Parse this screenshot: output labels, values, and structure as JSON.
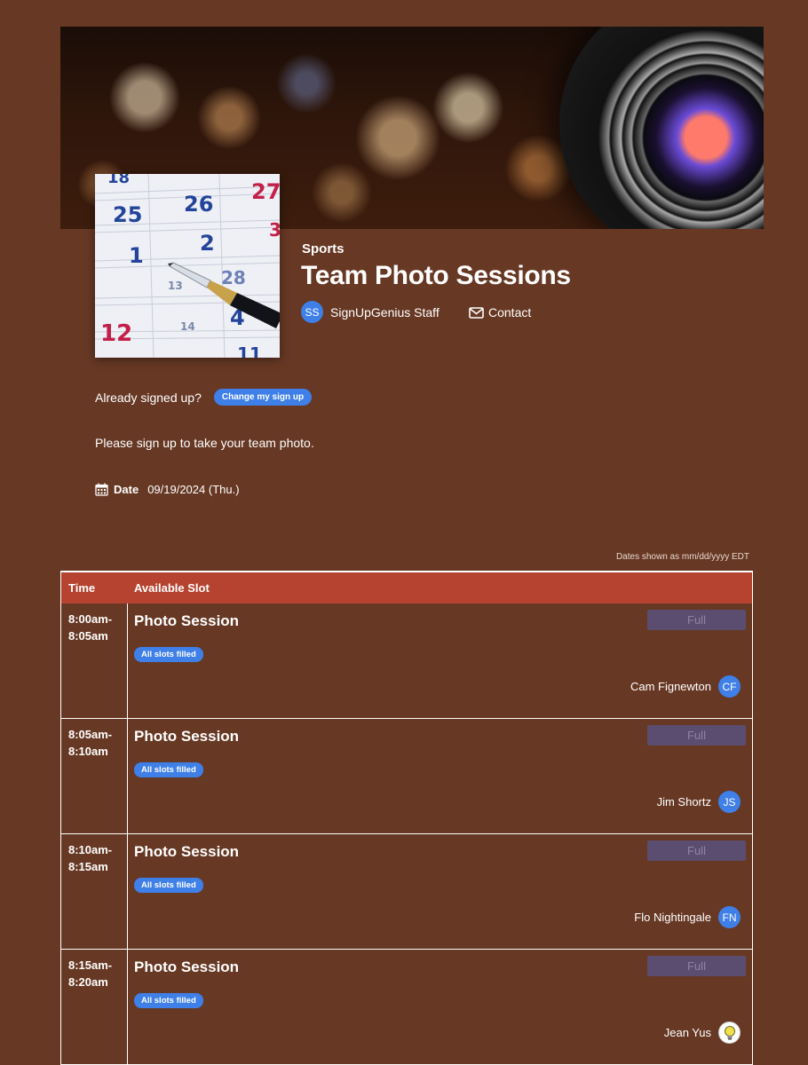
{
  "header": {
    "category": "Sports",
    "title": "Team Photo Sessions",
    "organizer": {
      "initials": "SS",
      "name": "SignUpGenius Staff"
    },
    "contact_label": "Contact"
  },
  "thumbnail": {
    "dates": [
      "18",
      "25",
      "26",
      "27",
      "1",
      "2",
      "3",
      "12",
      "13",
      "14",
      "4",
      "28",
      "11"
    ]
  },
  "signed_up": {
    "prompt": "Already signed up?",
    "button_label": "Change my sign up"
  },
  "description": "Please sign up to take your team photo.",
  "date": {
    "label": "Date",
    "value": "09/19/2024 (Thu.)"
  },
  "timezone_note": "Dates shown as mm/dd/yyyy EDT",
  "table": {
    "headers": {
      "time": "Time",
      "slot": "Available Slot"
    },
    "rows": [
      {
        "time_start": "8:00am-",
        "time_end": "8:05am",
        "title": "Photo Session",
        "badge": "All slots filled",
        "button": "Full",
        "participant": "Cam Fignewton",
        "initials": "CF"
      },
      {
        "time_start": "8:05am-",
        "time_end": "8:10am",
        "title": "Photo Session",
        "badge": "All slots filled",
        "button": "Full",
        "participant": "Jim Shortz",
        "initials": "JS"
      },
      {
        "time_start": "8:10am-",
        "time_end": "8:15am",
        "title": "Photo Session",
        "badge": "All slots filled",
        "button": "Full",
        "participant": "Flo Nightingale",
        "initials": "FN"
      },
      {
        "time_start": "8:15am-",
        "time_end": "8:20am",
        "title": "Photo Session",
        "badge": "All slots filled",
        "button": "Full",
        "participant": "Jean Yus",
        "initials": ""
      }
    ]
  },
  "colors": {
    "page_bg": "#673824",
    "header_row": "#b54330",
    "accent_blue": "#3f7fe8",
    "full_button": "#5a4d70"
  }
}
